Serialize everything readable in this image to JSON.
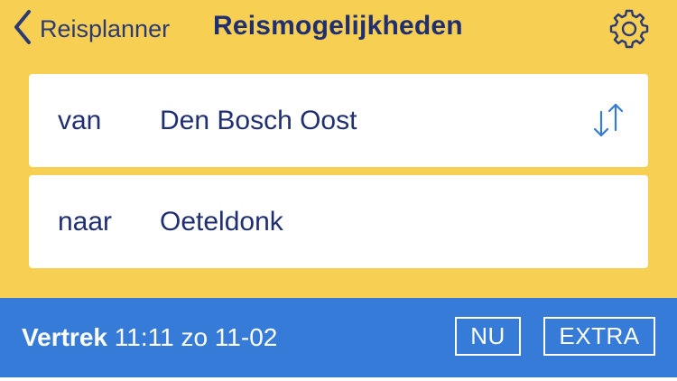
{
  "nav": {
    "back_label": "Reisplanner",
    "title": "Reismogelijkheden",
    "back_icon": "chevron-left-icon",
    "settings_icon": "gear-icon"
  },
  "route": {
    "from_label": "van",
    "from_value": "Den Bosch Oost",
    "to_label": "naar",
    "to_value": "Oeteldonk",
    "swap_icon": "swap-arrows-icon"
  },
  "departure": {
    "label": "Vertrek",
    "time": "11:11",
    "date": "zo 11-02",
    "now_button": "NU",
    "extra_button": "EXTRA"
  },
  "colors": {
    "header_bg": "#f7cf53",
    "text_navy": "#1f2f72",
    "accent_blue": "#367bd8",
    "card_bg": "#ffffff"
  }
}
